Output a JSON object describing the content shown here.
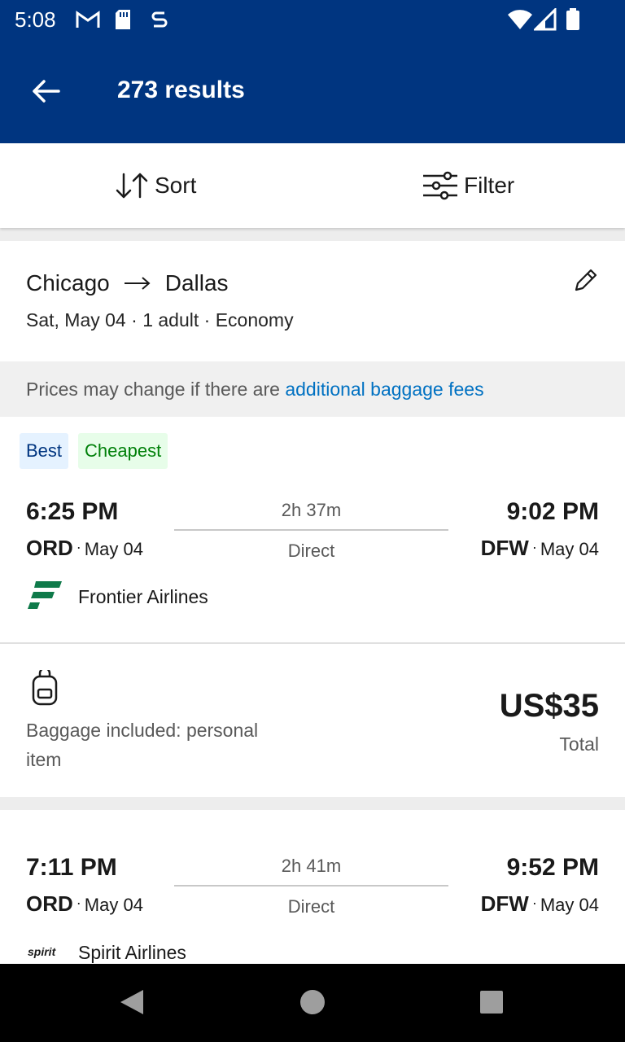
{
  "status_bar": {
    "time": "5:08"
  },
  "header": {
    "back_icon": "arrow-left-icon",
    "title": "273 results"
  },
  "toolbar": {
    "sort_label": "Sort",
    "filter_label": "Filter"
  },
  "search": {
    "origin": "Chicago",
    "destination": "Dallas",
    "date": "Sat, May 04",
    "sep": "·",
    "passengers": "1 adult",
    "cabin": "Economy"
  },
  "notice": {
    "text": "Prices may change if there are ",
    "link": "additional baggage fees"
  },
  "flights": [
    {
      "badges": [
        "Best",
        "Cheapest"
      ],
      "depart_time": "6:25 PM",
      "depart_airport": "ORD",
      "depart_date": "May 04",
      "duration": "2h 37m",
      "stops": "Direct",
      "arrive_time": "9:02 PM",
      "arrive_airport": "DFW",
      "arrive_date": "May 04",
      "airline": "Frontier Airlines",
      "baggage": "Baggage included: personal item",
      "price": "US$35",
      "price_label": "Total"
    },
    {
      "depart_time": "7:11 PM",
      "depart_airport": "ORD",
      "depart_date": "May 04",
      "duration": "2h 41m",
      "stops": "Direct",
      "arrive_time": "9:52 PM",
      "arrive_airport": "DFW",
      "arrive_date": "May 04",
      "airline": "Spirit Airlines",
      "airline_logo_text": "spirit"
    }
  ],
  "colors": {
    "brand": "#003580",
    "link": "#0071c2",
    "best_bg": "#e5f2ff",
    "cheapest_fg": "#008009",
    "frontier": "#0f7a4a"
  }
}
